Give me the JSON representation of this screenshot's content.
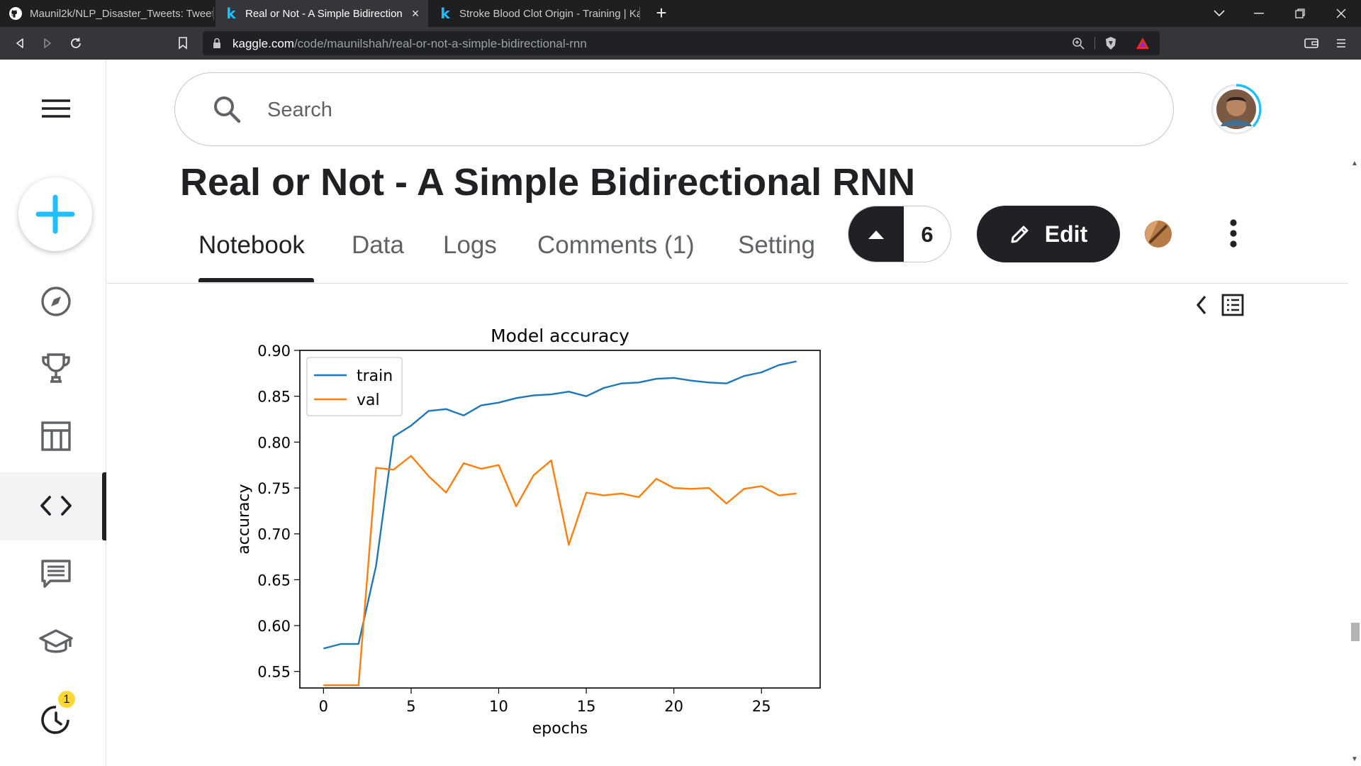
{
  "browser": {
    "tabs": [
      {
        "title": "Maunil2k/NLP_Disaster_Tweets: Tweet",
        "icon": "github-icon"
      },
      {
        "title": "Real or Not - A Simple Bidirection",
        "icon": "kaggle-k-icon"
      },
      {
        "title": "Stroke Blood Clot Origin - Training | Ka",
        "icon": "kaggle-k-icon"
      }
    ],
    "url_host": "kaggle.com",
    "url_path": "/code/maunilshah/real-or-not-a-simple-bidirectional-rnn"
  },
  "search": {
    "placeholder": "Search"
  },
  "sidebar": {
    "items": [
      {
        "name": "menu",
        "icon": "hamburger-icon"
      },
      {
        "name": "create",
        "icon": "plus-icon"
      },
      {
        "name": "datasets-explore",
        "icon": "compass-icon"
      },
      {
        "name": "competitions",
        "icon": "trophy-icon"
      },
      {
        "name": "datasets",
        "icon": "table-icon"
      },
      {
        "name": "code",
        "icon": "code-icon"
      },
      {
        "name": "discussions",
        "icon": "comment-icon"
      },
      {
        "name": "learn",
        "icon": "graduation-cap-icon"
      },
      {
        "name": "recently-viewed",
        "icon": "history-clock-icon"
      }
    ],
    "notification_badge": "1"
  },
  "notebook": {
    "title": "Real or Not - A Simple Bidirectional RNN",
    "tabs": [
      "Notebook",
      "Data",
      "Logs",
      "Comments (1)",
      "Setting"
    ],
    "active_tab": "Notebook",
    "votes": "6",
    "edit_label": "Edit"
  },
  "colors": {
    "accent": "#20beff",
    "dark": "#202124",
    "train_line": "#1f77b4",
    "val_line": "#ff7f0e"
  },
  "chart_data": {
    "type": "line",
    "title": "Model accuracy",
    "xlabel": "epochs",
    "ylabel": "accuracy",
    "xlim": [
      -1.35,
      28.35
    ],
    "ylim": [
      0.532,
      0.9
    ],
    "xticks": [
      0,
      5,
      10,
      15,
      20,
      25
    ],
    "yticks": [
      0.55,
      0.6,
      0.65,
      0.7,
      0.75,
      0.8,
      0.85,
      0.9
    ],
    "ytick_labels": [
      "0.55",
      "0.60",
      "0.65",
      "0.70",
      "0.75",
      "0.80",
      "0.85",
      "0.90"
    ],
    "legend_position": "upper-left",
    "x": [
      0,
      1,
      2,
      3,
      4,
      5,
      6,
      7,
      8,
      9,
      10,
      11,
      12,
      13,
      14,
      15,
      16,
      17,
      18,
      19,
      20,
      21,
      22,
      23,
      24,
      25,
      26,
      27
    ],
    "series": [
      {
        "name": "train",
        "color": "#1f77b4",
        "values": [
          0.575,
          0.58,
          0.58,
          0.665,
          0.806,
          0.818,
          0.834,
          0.836,
          0.829,
          0.84,
          0.843,
          0.848,
          0.851,
          0.852,
          0.855,
          0.85,
          0.859,
          0.864,
          0.865,
          0.869,
          0.87,
          0.867,
          0.865,
          0.864,
          0.872,
          0.876,
          0.884,
          0.888
        ]
      },
      {
        "name": "val",
        "color": "#ff7f0e",
        "values": [
          0.535,
          0.535,
          0.535,
          0.772,
          0.77,
          0.785,
          0.763,
          0.745,
          0.777,
          0.771,
          0.775,
          0.73,
          0.764,
          0.78,
          0.688,
          0.745,
          0.742,
          0.744,
          0.74,
          0.76,
          0.75,
          0.749,
          0.75,
          0.733,
          0.749,
          0.752,
          0.742,
          0.744
        ]
      }
    ]
  }
}
